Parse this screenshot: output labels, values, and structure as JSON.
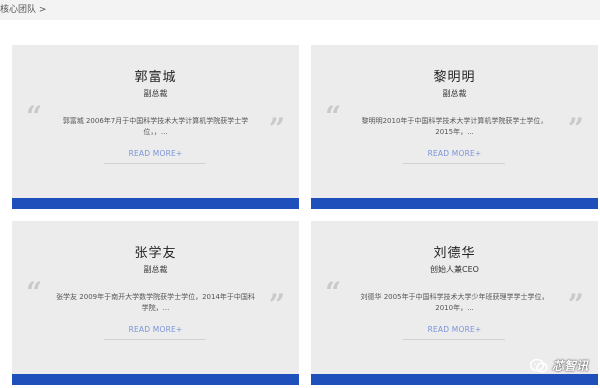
{
  "breadcrumb": {
    "label": "核心团队",
    "separator": ">"
  },
  "cards": [
    {
      "name": "郭富城",
      "role": "副总裁",
      "bio_line1": "郭富城 2006年7月于中国科学技术大学计算机学院获学士学",
      "bio_line2": "位，，...",
      "more": "READ MORE+"
    },
    {
      "name": "黎明明",
      "role": "副总裁",
      "bio_line1": "黎明明2010年于中国科学技术大学计算机学院获学士学位，",
      "bio_line2": "2015年，...",
      "more": "READ MORE+"
    },
    {
      "name": "张学友",
      "role": "副总裁",
      "bio_line1": "张学友 2009年于南开大学数学院获学士学位，2014年于中国科",
      "bio_line2": "学院，...",
      "more": "READ MORE+"
    },
    {
      "name": "刘德华",
      "role": "创始人兼CEO",
      "bio_line1": "刘德华 2005年于中国科学技术大学少年班获理学学士学位，",
      "bio_line2": "2010年，...",
      "more": "READ MORE+"
    }
  ],
  "watermark": {
    "text": "芯智讯",
    "icon": "wechat-icon"
  },
  "colors": {
    "accent_bar": "#1f4fbb",
    "card_bg": "#ececec",
    "link": "#7c93d8"
  }
}
